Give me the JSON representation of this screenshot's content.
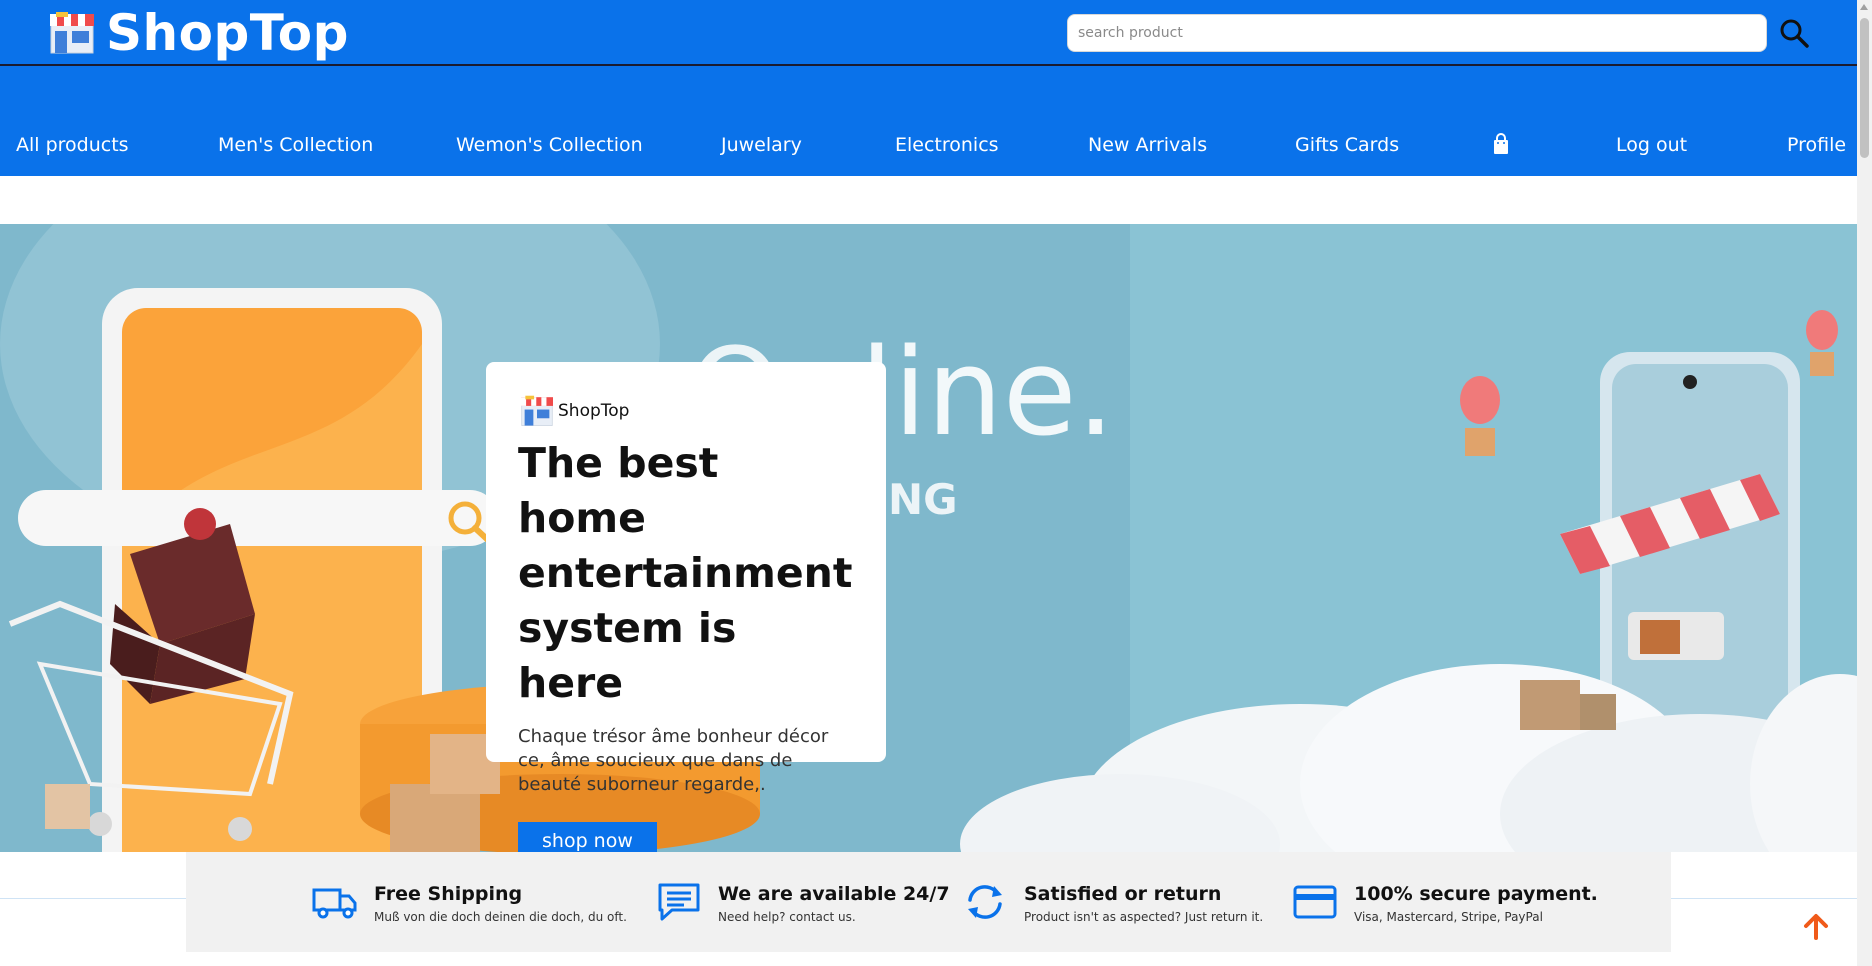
{
  "header": {
    "brand": "ShopTop",
    "search_placeholder": "search product"
  },
  "nav": {
    "items": [
      {
        "label": "All products"
      },
      {
        "label": "Men's Collection"
      },
      {
        "label": "Wemon's Collection"
      },
      {
        "label": "Juwelary"
      },
      {
        "label": "Electronics"
      },
      {
        "label": "New Arrivals"
      },
      {
        "label": "Gifts Cards"
      },
      {
        "label": "Log out"
      },
      {
        "label": "Profile"
      }
    ],
    "cart_icon": "shopping-bag-icon"
  },
  "hero": {
    "brand": "ShopTop",
    "title": "The best home entertainment system is here",
    "text": "Chaque trésor âme bonheur décor ce, âme soucieux que dans de beauté suborneur regarde,.",
    "button": "shop now",
    "background_text_1": "line.",
    "background_text_2": "NG"
  },
  "features": [
    {
      "icon": "truck-icon",
      "title": "Free Shipping",
      "subtitle": "Muß von die doch deinen die doch, du oft."
    },
    {
      "icon": "chat-icon",
      "title": "We are available 24/7",
      "subtitle": "Need help? contact us."
    },
    {
      "icon": "refresh-icon",
      "title": "Satisfied or return",
      "subtitle": "Product isn't as aspected? Just return it."
    },
    {
      "icon": "credit-card-icon",
      "title": "100% secure payment.",
      "subtitle": "Visa, Mastercard, Stripe, PayPal"
    }
  ],
  "colors": {
    "primary": "#0a72ea",
    "accent": "#f05a1a"
  }
}
